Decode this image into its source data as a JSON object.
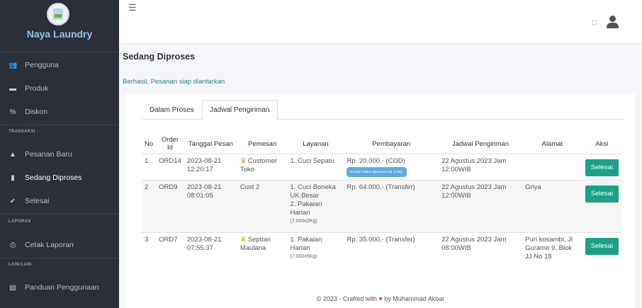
{
  "sidebar": {
    "brand": "Naya Laundry",
    "items": [
      {
        "label": "Pengguna",
        "icon": "users-icon"
      },
      {
        "label": "Produk",
        "icon": "briefcase-icon"
      },
      {
        "label": "Diskon",
        "icon": "percent-icon"
      },
      {
        "label": "Pesanan Baru",
        "icon": "warning-icon"
      },
      {
        "label": "Sedang Diproses",
        "icon": "clipboard-icon"
      },
      {
        "label": "Selesai",
        "icon": "check-icon"
      },
      {
        "label": "Cetak Laporan",
        "icon": "print-icon"
      },
      {
        "label": "Panduan Penggunaan",
        "icon": "book-icon"
      }
    ],
    "headers": [
      "TRANSAKSI",
      "LAPORAN",
      "LAIN-LAIN"
    ]
  },
  "topbar": {
    "menu_icon": "hamburger-icon",
    "fullscreen_icon": "expand-icon",
    "user_icon": "user-icon"
  },
  "page": {
    "title": "Sedang Diproses",
    "alert": "Berhasil, Pesanan siap diantarkan"
  },
  "tabs": [
    "Dalam Proses",
    "Jadwal Pengiriman"
  ],
  "table": {
    "headers": [
      "No",
      "Order Id",
      "Tanggal Pesan",
      "Pemesan",
      "Layanan",
      "Pembayaran",
      "Jadwal Pengiriman",
      "Alamat",
      "Aksi"
    ],
    "action_label": "Selesai",
    "rows": [
      {
        "no": "1",
        "order_id": "ORD14",
        "date": "2023-08-21",
        "time": "12:20:17",
        "customer": "Customer Toko",
        "vip": true,
        "services": [
          {
            "name": "1. Cuci Sepatu",
            "detail": ""
          }
        ],
        "payment": "Rp. 20.000,- (COD)",
        "voucher": "Voucher diskon digunakan Rp. 5.000,-",
        "schedule": "22 Agustus 2023 Jam 12:00WIB",
        "address": ""
      },
      {
        "no": "2",
        "order_id": "ORD9",
        "date": "2023-08-21",
        "time": "08:01:05",
        "customer": "Cust 2",
        "vip": false,
        "services": [
          {
            "name": "1. Cuci Boneka UK.Besar",
            "detail": ""
          },
          {
            "name": "2. Pakaian Harian",
            "detail": "(7.000x2Kg)"
          }
        ],
        "payment": "Rp. 64.000,- (Transfer)",
        "voucher": "",
        "schedule": "22 Agustus 2023 Jam 12:00WIB",
        "address": "Griya"
      },
      {
        "no": "3",
        "order_id": "ORD7",
        "date": "2023-08-21",
        "time": "07:55:37",
        "customer": "Septian Maulana",
        "vip": true,
        "services": [
          {
            "name": "1. Pakaian Harian",
            "detail": "(7.000x5Kg)"
          }
        ],
        "payment": "Rp. 35.000,- (Transfer)",
        "voucher": "",
        "schedule": "22 Agustus 2023 Jam 08:00WIB",
        "address": "Puri kosambi, Jl Gurame 9, Blok JJ No 18"
      }
    ]
  },
  "footer": {
    "prefix": "© 2023 - Crafted with",
    "suffix": "by Muhammad Akbar"
  },
  "colors": {
    "sidebar_bg": "#2b3038",
    "brand": "#8ec5f0",
    "success": "#1ba186",
    "alert_text": "#1b8a8a",
    "heart": "#e53935"
  }
}
